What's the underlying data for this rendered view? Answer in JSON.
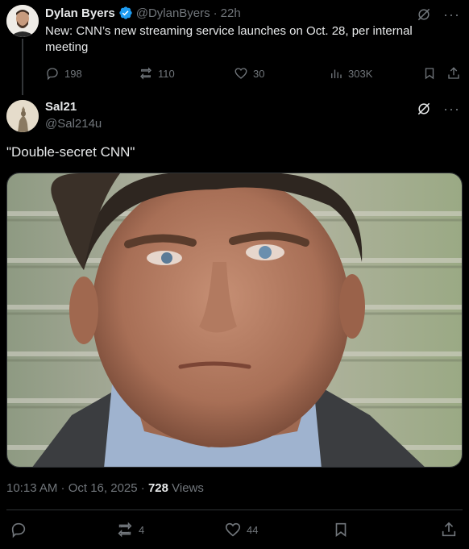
{
  "quoted": {
    "name": "Dylan Byers",
    "handle": "@DylanByers",
    "dot": "·",
    "time": "22h",
    "text": "New: CNN’s new streaming service launches on Oct. 28, per internal meeting",
    "stats": {
      "replies": "198",
      "reposts": "110",
      "likes": "30",
      "views": "303K"
    }
  },
  "post": {
    "name": "Sal21",
    "handle": "@Sal214u",
    "text": "\"Double-secret CNN\"",
    "timestamp": "10:13 AM · Oct 16, 2025 · ",
    "views_count": "728",
    "views_label": " Views",
    "stats": {
      "reposts": "4",
      "likes": "44"
    }
  },
  "colors": {
    "background": "#000000",
    "text": "#e7e9ea",
    "muted": "#71767b",
    "verified": "#1d9bf0",
    "border": "#2f3336"
  }
}
